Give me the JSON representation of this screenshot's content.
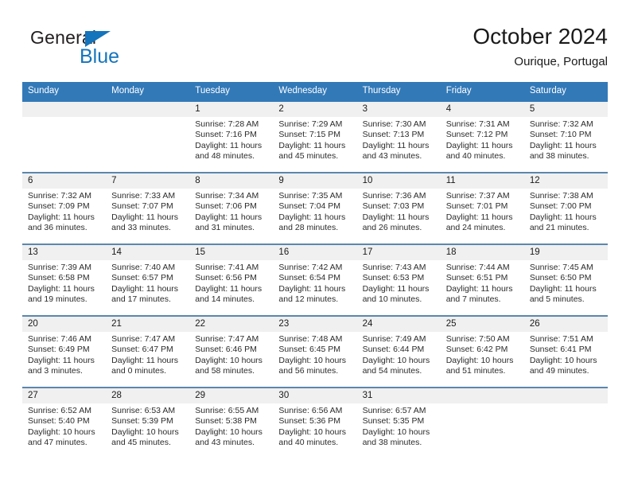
{
  "brand": {
    "name_part1": "General",
    "name_part2": "Blue",
    "triangle_color": "#1474bc"
  },
  "header": {
    "title": "October 2024",
    "location": "Ourique, Portugal"
  },
  "theme": {
    "header_blue": "#3279b8",
    "row_border": "#5b87ad",
    "day_band": "#f0f0f0"
  },
  "weekdays": [
    "Sunday",
    "Monday",
    "Tuesday",
    "Wednesday",
    "Thursday",
    "Friday",
    "Saturday"
  ],
  "labels": {
    "sunrise_prefix": "Sunrise:",
    "sunset_prefix": "Sunset:",
    "daylight_prefix": "Daylight:"
  },
  "weeks": [
    [
      {
        "empty": true
      },
      {
        "empty": true
      },
      {
        "day": "1",
        "sunrise": "Sunrise: 7:28 AM",
        "sunset": "Sunset: 7:16 PM",
        "daylight": "Daylight: 11 hours and 48 minutes."
      },
      {
        "day": "2",
        "sunrise": "Sunrise: 7:29 AM",
        "sunset": "Sunset: 7:15 PM",
        "daylight": "Daylight: 11 hours and 45 minutes."
      },
      {
        "day": "3",
        "sunrise": "Sunrise: 7:30 AM",
        "sunset": "Sunset: 7:13 PM",
        "daylight": "Daylight: 11 hours and 43 minutes."
      },
      {
        "day": "4",
        "sunrise": "Sunrise: 7:31 AM",
        "sunset": "Sunset: 7:12 PM",
        "daylight": "Daylight: 11 hours and 40 minutes."
      },
      {
        "day": "5",
        "sunrise": "Sunrise: 7:32 AM",
        "sunset": "Sunset: 7:10 PM",
        "daylight": "Daylight: 11 hours and 38 minutes."
      }
    ],
    [
      {
        "day": "6",
        "sunrise": "Sunrise: 7:32 AM",
        "sunset": "Sunset: 7:09 PM",
        "daylight": "Daylight: 11 hours and 36 minutes."
      },
      {
        "day": "7",
        "sunrise": "Sunrise: 7:33 AM",
        "sunset": "Sunset: 7:07 PM",
        "daylight": "Daylight: 11 hours and 33 minutes."
      },
      {
        "day": "8",
        "sunrise": "Sunrise: 7:34 AM",
        "sunset": "Sunset: 7:06 PM",
        "daylight": "Daylight: 11 hours and 31 minutes."
      },
      {
        "day": "9",
        "sunrise": "Sunrise: 7:35 AM",
        "sunset": "Sunset: 7:04 PM",
        "daylight": "Daylight: 11 hours and 28 minutes."
      },
      {
        "day": "10",
        "sunrise": "Sunrise: 7:36 AM",
        "sunset": "Sunset: 7:03 PM",
        "daylight": "Daylight: 11 hours and 26 minutes."
      },
      {
        "day": "11",
        "sunrise": "Sunrise: 7:37 AM",
        "sunset": "Sunset: 7:01 PM",
        "daylight": "Daylight: 11 hours and 24 minutes."
      },
      {
        "day": "12",
        "sunrise": "Sunrise: 7:38 AM",
        "sunset": "Sunset: 7:00 PM",
        "daylight": "Daylight: 11 hours and 21 minutes."
      }
    ],
    [
      {
        "day": "13",
        "sunrise": "Sunrise: 7:39 AM",
        "sunset": "Sunset: 6:58 PM",
        "daylight": "Daylight: 11 hours and 19 minutes."
      },
      {
        "day": "14",
        "sunrise": "Sunrise: 7:40 AM",
        "sunset": "Sunset: 6:57 PM",
        "daylight": "Daylight: 11 hours and 17 minutes."
      },
      {
        "day": "15",
        "sunrise": "Sunrise: 7:41 AM",
        "sunset": "Sunset: 6:56 PM",
        "daylight": "Daylight: 11 hours and 14 minutes."
      },
      {
        "day": "16",
        "sunrise": "Sunrise: 7:42 AM",
        "sunset": "Sunset: 6:54 PM",
        "daylight": "Daylight: 11 hours and 12 minutes."
      },
      {
        "day": "17",
        "sunrise": "Sunrise: 7:43 AM",
        "sunset": "Sunset: 6:53 PM",
        "daylight": "Daylight: 11 hours and 10 minutes."
      },
      {
        "day": "18",
        "sunrise": "Sunrise: 7:44 AM",
        "sunset": "Sunset: 6:51 PM",
        "daylight": "Daylight: 11 hours and 7 minutes."
      },
      {
        "day": "19",
        "sunrise": "Sunrise: 7:45 AM",
        "sunset": "Sunset: 6:50 PM",
        "daylight": "Daylight: 11 hours and 5 minutes."
      }
    ],
    [
      {
        "day": "20",
        "sunrise": "Sunrise: 7:46 AM",
        "sunset": "Sunset: 6:49 PM",
        "daylight": "Daylight: 11 hours and 3 minutes."
      },
      {
        "day": "21",
        "sunrise": "Sunrise: 7:47 AM",
        "sunset": "Sunset: 6:47 PM",
        "daylight": "Daylight: 11 hours and 0 minutes."
      },
      {
        "day": "22",
        "sunrise": "Sunrise: 7:47 AM",
        "sunset": "Sunset: 6:46 PM",
        "daylight": "Daylight: 10 hours and 58 minutes."
      },
      {
        "day": "23",
        "sunrise": "Sunrise: 7:48 AM",
        "sunset": "Sunset: 6:45 PM",
        "daylight": "Daylight: 10 hours and 56 minutes."
      },
      {
        "day": "24",
        "sunrise": "Sunrise: 7:49 AM",
        "sunset": "Sunset: 6:44 PM",
        "daylight": "Daylight: 10 hours and 54 minutes."
      },
      {
        "day": "25",
        "sunrise": "Sunrise: 7:50 AM",
        "sunset": "Sunset: 6:42 PM",
        "daylight": "Daylight: 10 hours and 51 minutes."
      },
      {
        "day": "26",
        "sunrise": "Sunrise: 7:51 AM",
        "sunset": "Sunset: 6:41 PM",
        "daylight": "Daylight: 10 hours and 49 minutes."
      }
    ],
    [
      {
        "day": "27",
        "sunrise": "Sunrise: 6:52 AM",
        "sunset": "Sunset: 5:40 PM",
        "daylight": "Daylight: 10 hours and 47 minutes."
      },
      {
        "day": "28",
        "sunrise": "Sunrise: 6:53 AM",
        "sunset": "Sunset: 5:39 PM",
        "daylight": "Daylight: 10 hours and 45 minutes."
      },
      {
        "day": "29",
        "sunrise": "Sunrise: 6:55 AM",
        "sunset": "Sunset: 5:38 PM",
        "daylight": "Daylight: 10 hours and 43 minutes."
      },
      {
        "day": "30",
        "sunrise": "Sunrise: 6:56 AM",
        "sunset": "Sunset: 5:36 PM",
        "daylight": "Daylight: 10 hours and 40 minutes."
      },
      {
        "day": "31",
        "sunrise": "Sunrise: 6:57 AM",
        "sunset": "Sunset: 5:35 PM",
        "daylight": "Daylight: 10 hours and 38 minutes."
      },
      {
        "empty": true
      },
      {
        "empty": true
      }
    ]
  ]
}
